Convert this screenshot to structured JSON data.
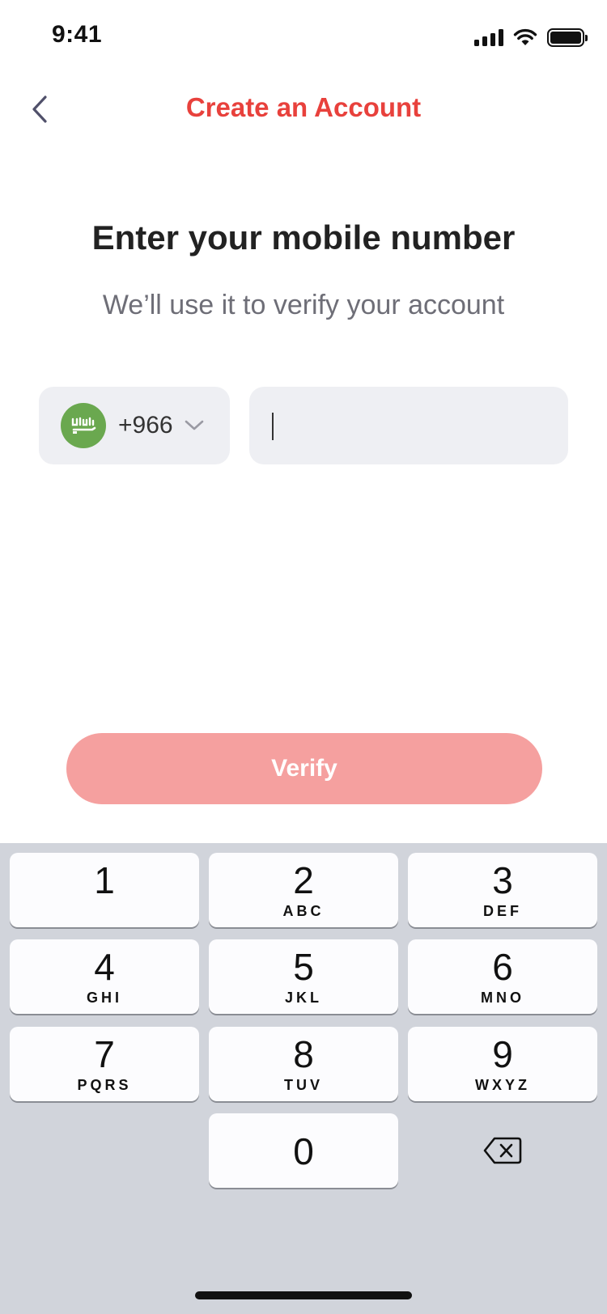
{
  "status_bar": {
    "time": "9:41"
  },
  "nav": {
    "title": "Create an Account"
  },
  "heading": "Enter your mobile number",
  "subheading": "We’ll use it to verify your account",
  "country": {
    "dial_code": "+966",
    "flag_text": "لا"
  },
  "phone": {
    "value": "",
    "placeholder": ""
  },
  "verify_label": "Verify",
  "keypad": {
    "k1": {
      "digit": "1",
      "letters": ""
    },
    "k2": {
      "digit": "2",
      "letters": "ABC"
    },
    "k3": {
      "digit": "3",
      "letters": "DEF"
    },
    "k4": {
      "digit": "4",
      "letters": "GHI"
    },
    "k5": {
      "digit": "5",
      "letters": "JKL"
    },
    "k6": {
      "digit": "6",
      "letters": "MNO"
    },
    "k7": {
      "digit": "7",
      "letters": "PQRS"
    },
    "k8": {
      "digit": "8",
      "letters": "TUV"
    },
    "k9": {
      "digit": "9",
      "letters": "WXYZ"
    },
    "k0": {
      "digit": "0",
      "letters": ""
    }
  },
  "colors": {
    "accent": "#e8413c",
    "verify_disabled": "#f5a09f",
    "field_bg": "#eeeff3",
    "keyboard_bg": "#d1d4db",
    "flag_green": "#6aa84f"
  }
}
